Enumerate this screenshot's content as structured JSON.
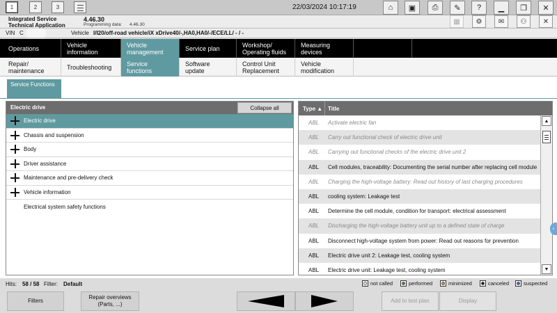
{
  "topbar": {
    "session_buttons": [
      "1",
      "2",
      "3"
    ],
    "datetime": "22/03/2024 10:17:19"
  },
  "app": {
    "name": "Integrated Service Technical Application",
    "version": "4.46.30",
    "programming_label": "Programming data:",
    "programming_value": "4.46.30"
  },
  "vehicle": {
    "vin_label": "VIN",
    "vin_value": "C",
    "vehicle_label": "Vehicle",
    "vehicle_value": "I/I20/off-road vehicle/iX xDrive40/-,HA0,HA0/-/ECE/LL/ - / -"
  },
  "nav_main": [
    {
      "label": "Operations"
    },
    {
      "label": "Vehicle information"
    },
    {
      "label": "Vehicle management"
    },
    {
      "label": "Service plan"
    },
    {
      "label": "Workshop/ Operating fluids"
    },
    {
      "label": "Measuring devices"
    }
  ],
  "nav_sub": [
    {
      "label": "Repair/ maintenance"
    },
    {
      "label": "Troubleshooting"
    },
    {
      "label": "Service functions"
    },
    {
      "label": "Software update"
    },
    {
      "label": "Control Unit Replacement"
    },
    {
      "label": "Vehicle modification"
    }
  ],
  "breadcrumb": "Service Functions",
  "left_panel": {
    "title": "Electric drive",
    "collapse_label": "Collapse all",
    "items": [
      {
        "label": "Electric drive"
      },
      {
        "label": "Chassis and suspension"
      },
      {
        "label": "Body"
      },
      {
        "label": "Driver assistance"
      },
      {
        "label": "Maintenance and pre-delivery check"
      },
      {
        "label": "Vehicle information"
      },
      {
        "label": "Electrical system safety functions"
      }
    ]
  },
  "right_panel": {
    "col_type": "Type",
    "col_title": "Title",
    "rows": [
      {
        "type": "ABL",
        "title": "Activate electric fan"
      },
      {
        "type": "ABL",
        "title": "Carry out functional check of electric drive unit"
      },
      {
        "type": "ABL",
        "title": "Carrying out functional checks of the electric drive unit 2"
      },
      {
        "type": "ABL",
        "title": "Cell modules, traceability: Documenting the serial number after replacing cell module"
      },
      {
        "type": "ABL",
        "title": "Charging the high-voltage battery: Read out history of last charging procedures"
      },
      {
        "type": "ABL",
        "title": "cooling system: Leakage test"
      },
      {
        "type": "ABL",
        "title": "Determine the cell module, condition for transport: electrical assessment"
      },
      {
        "type": "ABL",
        "title": "Discharging the high-voltage battery unit up to a defined state of charge"
      },
      {
        "type": "ABL",
        "title": "Disconnect high-voltage system from power: Read out reasons for prevention"
      },
      {
        "type": "ABL",
        "title": "Electric drive unit 2: Leakage test, cooling system"
      },
      {
        "type": "ABL",
        "title": "Electric drive unit: Leakage test, cooling system"
      }
    ]
  },
  "status": {
    "hits_label": "Hits:",
    "hits_value": "58 / 58",
    "filter_label": "Filter:",
    "filter_value": "Default",
    "legend": [
      {
        "label": "not called",
        "color": "#ffffff"
      },
      {
        "label": "performed",
        "color": "#3a9a3a"
      },
      {
        "label": "minimized",
        "color": "#b89a3a"
      },
      {
        "label": "canceled",
        "color": "#111111"
      },
      {
        "label": "suspected",
        "color": "#3a6ad8"
      }
    ]
  },
  "bottom": {
    "filters": "Filters",
    "repair_overviews": "Repair overviews (Parts, ...)",
    "add_to_test_plan": "Add to test plan",
    "display": "Display"
  },
  "colors": {
    "accent": "#5f9aa0"
  }
}
